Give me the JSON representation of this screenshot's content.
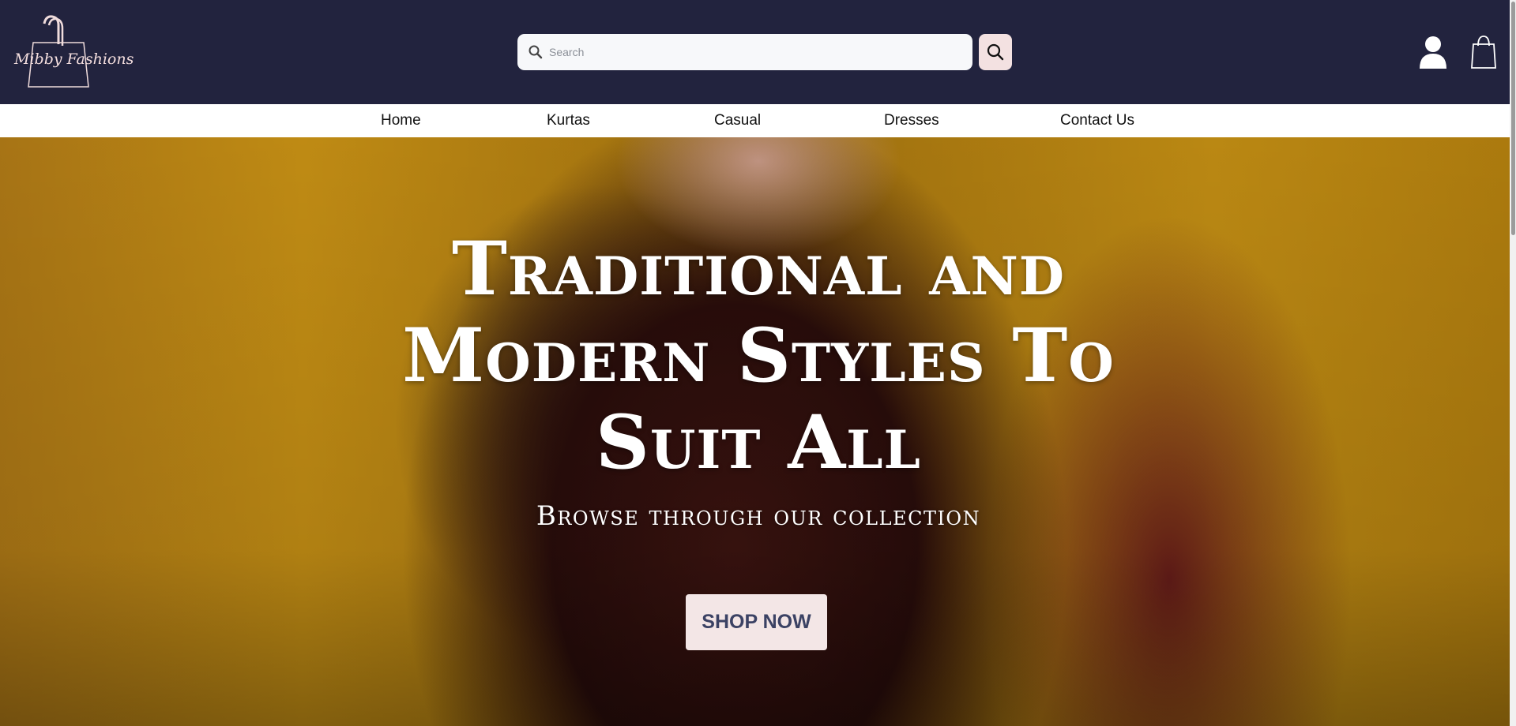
{
  "brand": {
    "logo_text": "Mibby Fashions"
  },
  "search": {
    "placeholder": "Search",
    "value": ""
  },
  "header_icons": [
    "user-icon",
    "shopping-bag-icon"
  ],
  "nav": {
    "items": [
      {
        "label": "Home"
      },
      {
        "label": "Kurtas"
      },
      {
        "label": "Casual"
      },
      {
        "label": "Dresses"
      },
      {
        "label": "Contact Us"
      }
    ]
  },
  "hero": {
    "title": "Traditional and Modern Styles To Suit All",
    "subtitle": "Browse through our collection",
    "cta_label": "SHOP NOW"
  },
  "colors": {
    "header_bg": "#22233e",
    "accent_pink": "#f3e1e1",
    "button_text": "#3b4264"
  }
}
